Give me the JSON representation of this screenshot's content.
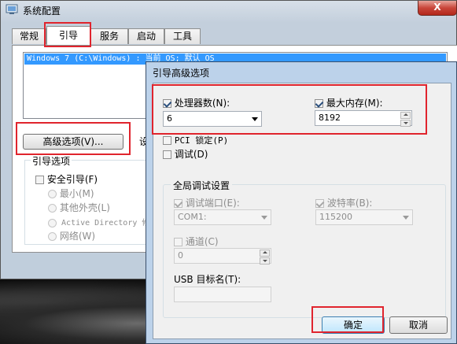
{
  "background_window": {
    "title": "系统配置",
    "close_glyph": "X",
    "tabs": [
      "常规",
      "引导",
      "服务",
      "启动",
      "工具"
    ],
    "active_tab": "引导",
    "os_entry": "Windows 7 (C:\\Windows) : 当前 OS; 默认 OS",
    "advanced_button": "高级选项(V)...",
    "set_default_peek": "设",
    "boot_options_title": "引导选项",
    "safe_boot_label": "安全引导(F)",
    "safe_boot_options": [
      "最小(M)",
      "其他外壳(L)",
      "Active Directory 修",
      "网络(W)"
    ]
  },
  "dialog": {
    "title": "引导高级选项",
    "num_processors": {
      "label": "处理器数(N):",
      "checked": true,
      "value": "6"
    },
    "max_memory": {
      "label": "最大内存(M):",
      "checked": true,
      "value": "8192"
    },
    "pci_lock": {
      "label": "PCI 锁定(P)",
      "checked": false
    },
    "debug": {
      "label": "调试(D)",
      "checked": false
    },
    "global_debug_title": "全局调试设置",
    "debug_port": {
      "label": "调试端口(E):",
      "checked": true,
      "value": "COM1:"
    },
    "baud_rate": {
      "label": "波特率(B):",
      "checked": true,
      "value": "115200"
    },
    "channel": {
      "label": "通道(C)",
      "checked": false,
      "value": "0"
    },
    "usb_target_label": "USB 目标名(T):",
    "usb_target_value": "",
    "ok_button": "确定",
    "cancel_button": "取消"
  },
  "colors": {
    "highlight_box": "#e0242d",
    "selection": "#3399ff",
    "dialog_frame": "#bcd2ea"
  }
}
